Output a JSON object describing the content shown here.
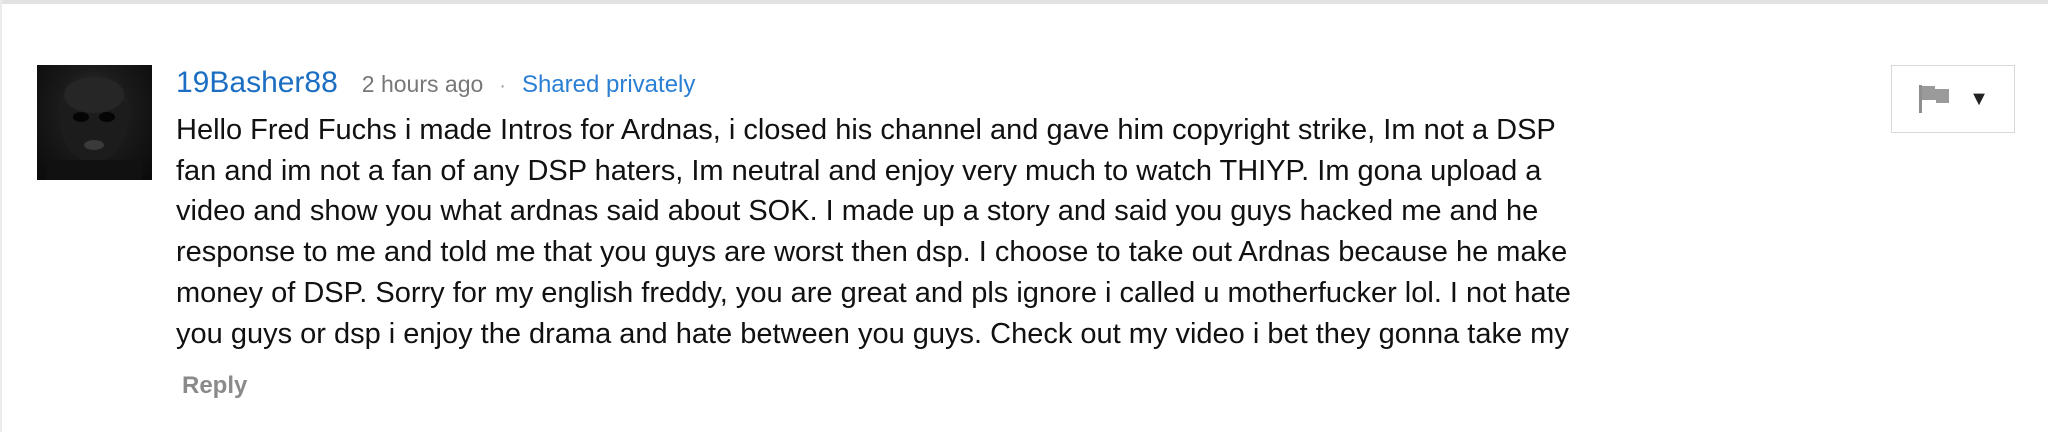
{
  "comment": {
    "author": "19Basher88",
    "time": "2 hours ago",
    "separator": "·",
    "visibility": "Shared privately",
    "lines": [
      "Hello Fred Fuchs i made Intros for Ardnas, i closed his channel and gave him copyright strike, Im not a DSP",
      "fan and im not a fan of any DSP haters, Im neutral and enjoy very much to watch THIYP. Im gona upload a",
      "video and show you what ardnas said about SOK. I made up a story and said you guys hacked me and he",
      "response to me and told me that you guys are worst then dsp. I choose to take out Ardnas because he make",
      "money of DSP. Sorry for my english freddy, you are great and pls ignore i called u motherfucker lol. I not hate",
      "you guys or dsp i enjoy the drama and hate between you guys. Check out my video i bet they gonna take my"
    ],
    "reply_label": "Reply"
  },
  "menu": {
    "flag_icon": "flag-icon",
    "caret": "▼"
  },
  "colors": {
    "author": "#1b6ec2",
    "link": "#2a7fd4",
    "muted": "#777777",
    "reply": "#8a8a8a",
    "text": "#111111",
    "border": "#d9d9d9"
  }
}
